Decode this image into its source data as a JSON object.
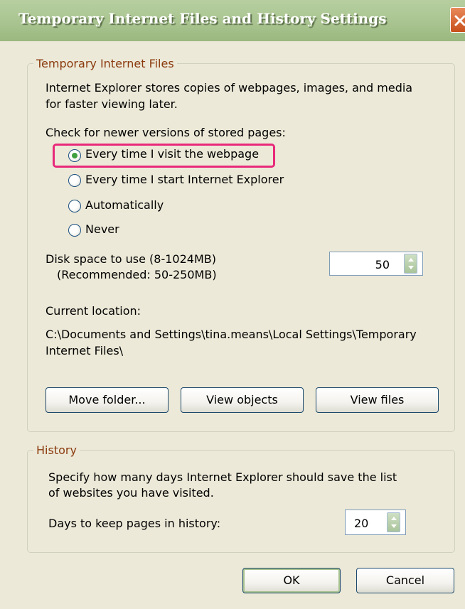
{
  "window": {
    "title": "Temporary Internet Files and History Settings",
    "close_icon": "close-icon"
  },
  "temp_files": {
    "legend": "Temporary Internet Files",
    "desc_line1": "Internet Explorer stores copies of webpages, images, and media",
    "desc_line2": "for faster viewing later.",
    "check_label": "Check for newer versions of stored pages:",
    "options": [
      {
        "label": "Every time I visit the webpage",
        "selected": true
      },
      {
        "label": "Every time I start Internet Explorer",
        "selected": false
      },
      {
        "label": "Automatically",
        "selected": false
      },
      {
        "label": "Never",
        "selected": false
      }
    ],
    "disk_label": "Disk space to use (8-1024MB)",
    "disk_recommended": "(Recommended: 50-250MB)",
    "disk_value": "50",
    "location_label": "Current location:",
    "location_line1": "C:\\Documents and Settings\\tina.means\\Local Settings\\Temporary",
    "location_line2": "Internet Files\\",
    "buttons": {
      "move_folder": "Move folder...",
      "view_objects": "View objects",
      "view_files": "View files"
    }
  },
  "history": {
    "legend": "History",
    "desc_line1": "Specify how many days Internet Explorer should save the list",
    "desc_line2": "of websites you have visited.",
    "days_label": "Days to keep pages in history:",
    "days_value": "20"
  },
  "footer": {
    "ok": "OK",
    "cancel": "Cancel"
  },
  "colors": {
    "titlebar": "#a9c490",
    "highlight": "#e8297a",
    "legend_text": "#8b3a0e",
    "radio_selected": "#3fa03f"
  }
}
